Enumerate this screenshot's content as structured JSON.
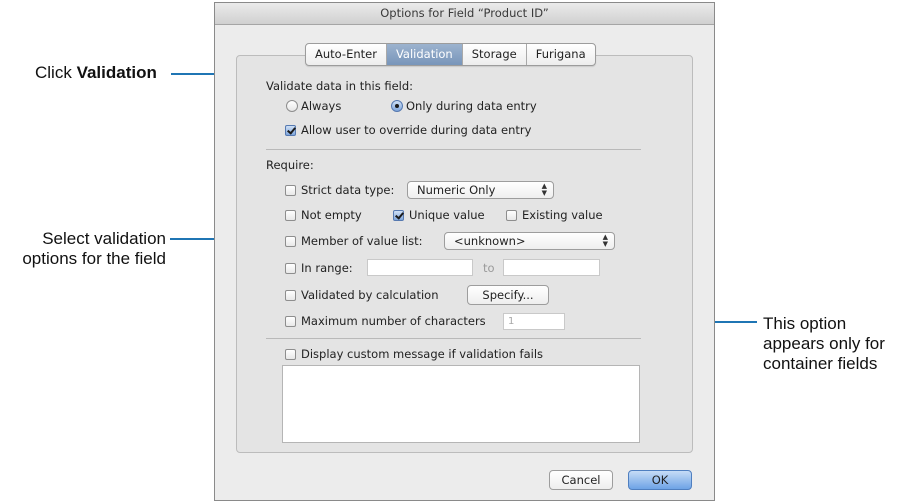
{
  "dialog": {
    "title": "Options for Field “Product ID”",
    "tabs": [
      {
        "label": "Auto-Enter",
        "active": false
      },
      {
        "label": "Validation",
        "active": true
      },
      {
        "label": "Storage",
        "active": false
      },
      {
        "label": "Furigana",
        "active": false
      }
    ],
    "validate_heading": "Validate data in this field:",
    "radio_always": "Always",
    "radio_only_during_entry": "Only during data entry",
    "allow_override": "Allow user to override during data entry",
    "require_heading": "Require:",
    "strict_data_type": "Strict data type:",
    "strict_data_type_value": "Numeric Only",
    "not_empty": "Not empty",
    "unique_value": "Unique value",
    "existing_value": "Existing value",
    "member_of_value_list": "Member of value list:",
    "member_value": "<unknown>",
    "in_range": "In range:",
    "range_to": "to",
    "validated_by_calc": "Validated by calculation",
    "specify_button": "Specify...",
    "max_chars": "Maximum number of characters",
    "max_chars_value": "1",
    "display_custom_message": "Display custom message if validation fails",
    "cancel_button": "Cancel",
    "ok_button": "OK"
  },
  "callouts": {
    "click_prefix": "Click ",
    "click_word": "Validation",
    "select_line1": "Select validation",
    "select_line2": "options for the field",
    "option_line1": "This option",
    "option_line2": "appears only for",
    "option_line3": "container fields"
  },
  "colors": {
    "callout_line": "#1f75b4",
    "active_tab": "#8ba4c6",
    "default_button": "#6ea3e6"
  }
}
